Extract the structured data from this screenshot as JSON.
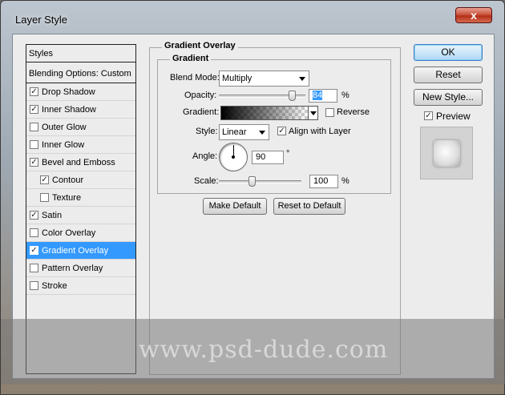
{
  "window": {
    "title": "Layer Style",
    "close_glyph": "x"
  },
  "styles_panel": {
    "header": "Styles",
    "blending_options": "Blending Options: Custom",
    "items": [
      {
        "label": "Drop Shadow",
        "checked": true,
        "sub": false,
        "selected": false
      },
      {
        "label": "Inner Shadow",
        "checked": true,
        "sub": false,
        "selected": false
      },
      {
        "label": "Outer Glow",
        "checked": false,
        "sub": false,
        "selected": false
      },
      {
        "label": "Inner Glow",
        "checked": false,
        "sub": false,
        "selected": false
      },
      {
        "label": "Bevel and Emboss",
        "checked": true,
        "sub": false,
        "selected": false
      },
      {
        "label": "Contour",
        "checked": true,
        "sub": true,
        "selected": false
      },
      {
        "label": "Texture",
        "checked": false,
        "sub": true,
        "selected": false
      },
      {
        "label": "Satin",
        "checked": true,
        "sub": false,
        "selected": false
      },
      {
        "label": "Color Overlay",
        "checked": false,
        "sub": false,
        "selected": false
      },
      {
        "label": "Gradient Overlay",
        "checked": true,
        "sub": false,
        "selected": true
      },
      {
        "label": "Pattern Overlay",
        "checked": false,
        "sub": false,
        "selected": false
      },
      {
        "label": "Stroke",
        "checked": false,
        "sub": false,
        "selected": false
      }
    ]
  },
  "gradient_overlay": {
    "outer_title": "Gradient Overlay",
    "inner_title": "Gradient",
    "blend_mode_label": "Blend Mode:",
    "blend_mode_value": "Multiply",
    "opacity_label": "Opacity:",
    "opacity_value": "84",
    "opacity_unit": "%",
    "opacity_fraction": 0.84,
    "gradient_label": "Gradient:",
    "reverse_label": "Reverse",
    "reverse_checked": false,
    "style_label": "Style:",
    "style_value": "Linear",
    "align_label": "Align with Layer",
    "align_checked": true,
    "angle_label": "Angle:",
    "angle_value": "90",
    "angle_unit": "°",
    "scale_label": "Scale:",
    "scale_value": "100",
    "scale_unit": "%",
    "scale_fraction": 0.4,
    "make_default": "Make Default",
    "reset_default": "Reset to Default"
  },
  "actions": {
    "ok": "OK",
    "reset": "Reset",
    "new_style": "New Style...",
    "preview_label": "Preview",
    "preview_checked": true
  },
  "watermark": "www.psd-dude.com",
  "colors": {
    "selection": "#3399ff",
    "client_bg": "#ececec",
    "close_red": "#c9553f"
  }
}
